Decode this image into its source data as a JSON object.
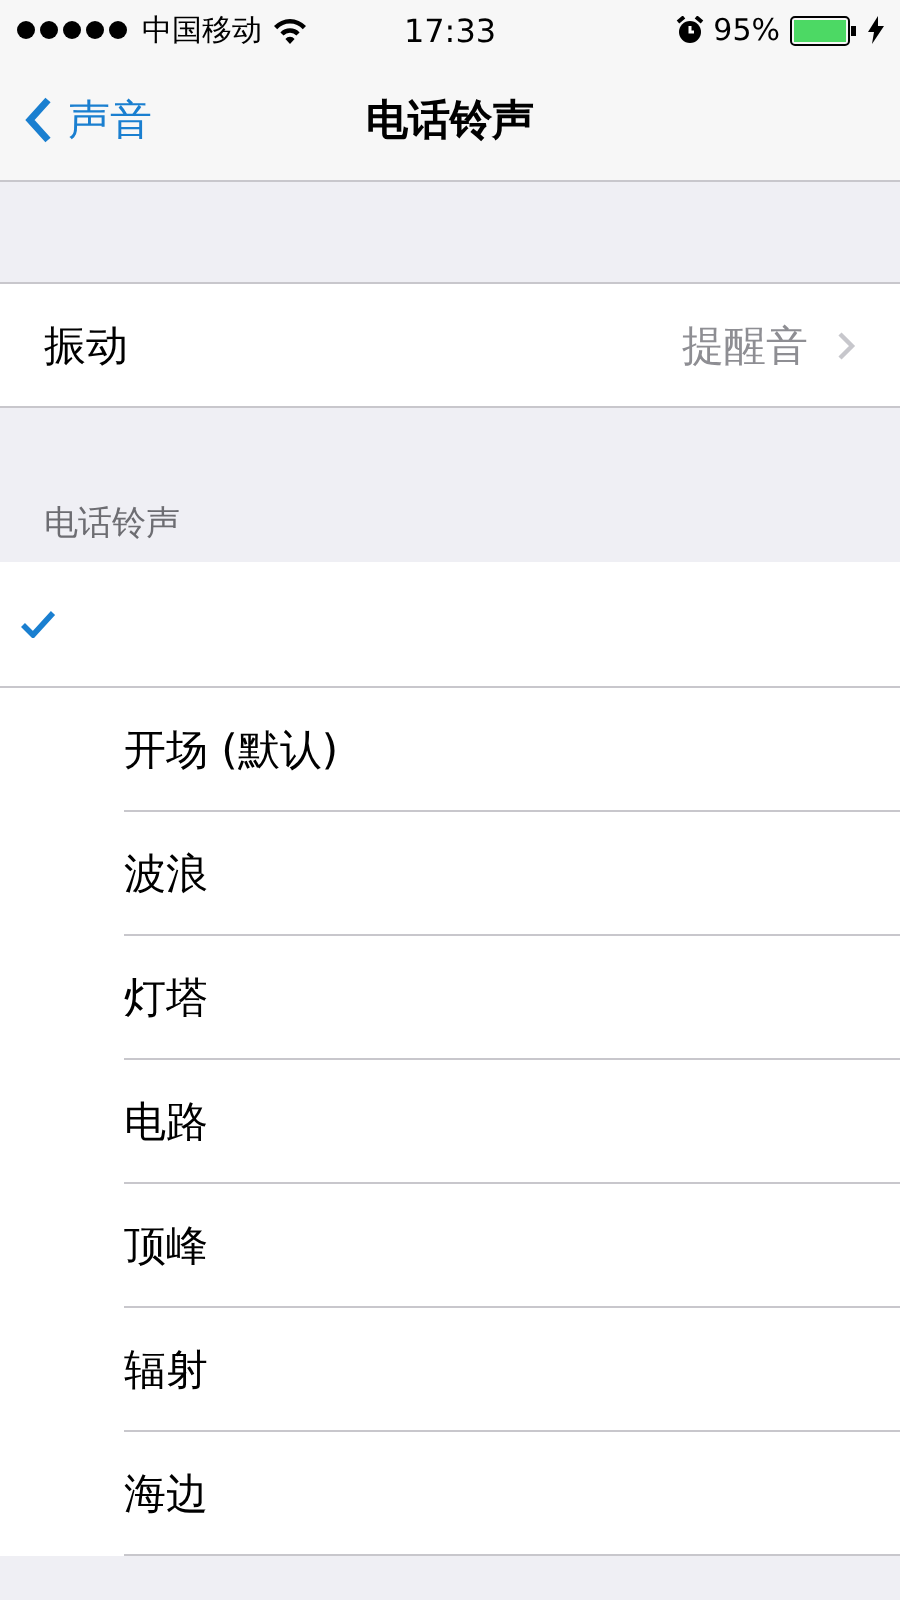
{
  "status_bar": {
    "carrier": "中国移动",
    "time": "17:33",
    "battery": "95%"
  },
  "nav": {
    "back": "声音",
    "title": "电话铃声"
  },
  "vibration": {
    "label": "振动",
    "value": "提醒音"
  },
  "section_header": "电话铃声",
  "ringtones": [
    {
      "selected": true
    },
    {
      "label": "开场 (默认)",
      "selected": false
    },
    {
      "label": "波浪",
      "selected": false
    },
    {
      "label": "灯塔",
      "selected": false
    },
    {
      "label": "电路",
      "selected": false
    },
    {
      "label": "顶峰",
      "selected": false
    },
    {
      "label": "辐射",
      "selected": false
    },
    {
      "label": "海边",
      "selected": false
    }
  ]
}
